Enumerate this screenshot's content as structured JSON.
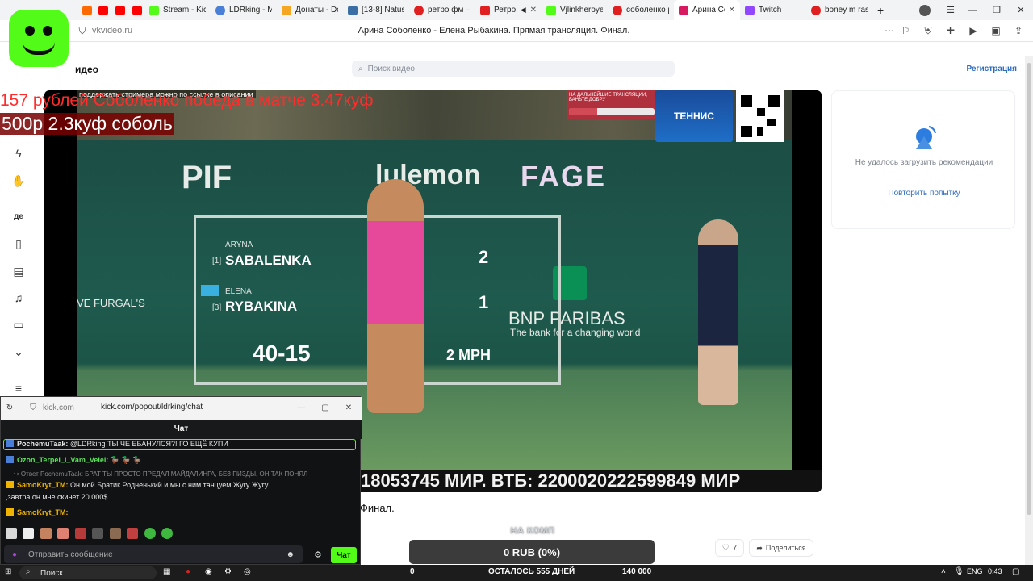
{
  "browser": {
    "tabs": [
      {
        "label": "",
        "color": "#ff6a00",
        "active": false
      },
      {
        "label": "",
        "color": "#ff0000",
        "active": false
      },
      {
        "label": "",
        "color": "#ff0000",
        "active": false
      },
      {
        "label": "",
        "color": "#ff0000",
        "active": false
      },
      {
        "label": "Stream - Kick",
        "color": "#53fc18",
        "active": false
      },
      {
        "label": "LDRking - Me",
        "color": "#4a7fd8",
        "active": false
      },
      {
        "label": "Донаты - Do",
        "color": "#f5a623",
        "active": false
      },
      {
        "label": "[13-8] Natus",
        "color": "#3a6ea5",
        "active": false
      },
      {
        "label": "ретро фм —",
        "color": "#e02020",
        "active": false
      },
      {
        "label": "Ретро F",
        "color": "#e02020",
        "active": false
      },
      {
        "label": "Vjlinkheroye",
        "color": "#53fc18",
        "active": false
      },
      {
        "label": "соболенко р",
        "color": "#e02020",
        "active": false
      },
      {
        "label": "Арина Со",
        "color": "#d81b60",
        "active": true
      },
      {
        "label": "Twitch",
        "color": "#9146ff",
        "active": false
      },
      {
        "label": "boney m rasp",
        "color": "#e02020",
        "active": false
      }
    ],
    "address_host": "vkvideo.ru",
    "page_title": "Арина Соболенко - Елена Рыбакина. Прямая трансляция. Финал."
  },
  "header": {
    "brand": "идео",
    "search_placeholder": "Поиск видео",
    "register": "Регистрация"
  },
  "stream_overlay": {
    "line1": "157 рублей Соболенко победа в матче 3.47куф",
    "line2": "500р 2.3куф соболь",
    "top_note": "поддержать стримера можно по ссылке в описании",
    "alert_text": "НА ДАЛЬНЕЙШИЕ ТРАНСЛЯЦИИ, БАНЬТЕ ДОБРУ",
    "alert_progress": 0.33,
    "tennis_logo": "ТЕННИС",
    "ticker": "18053745 МИР. ВТБ: 2200020222599849 МИР"
  },
  "court": {
    "sponsor_pif": "PIF",
    "sponsor_lulu": "lulemon",
    "sponsor_fage": "FAGE",
    "sponsor_bnp": "BNP PARIBAS",
    "sponsor_bnp_sub": "The bank for a changing world",
    "sponsor_left": "VE FURGAL'S",
    "player1_first": "ARYNA",
    "player1_last": "SABALENKA",
    "player1_seed": "[1]",
    "player1_set": "2",
    "player2_first": "ELENA",
    "player2_last": "RYBAKINA",
    "player2_seed": "[3]",
    "player2_set": "1",
    "game_score": "40-15",
    "speed": "2 MPH"
  },
  "recommendations": {
    "error": "Не удалось загрузить рекомендации",
    "retry": "Повторить попытку"
  },
  "video_info": {
    "title_fragment": "Финал.",
    "likes": "7",
    "share": "Поделиться"
  },
  "donation": {
    "label": "НА КОМП",
    "amount": "0 RUB (0%)",
    "left": "0",
    "remaining": "ОСТАЛОСЬ 555 ДНЕЙ",
    "goal": "140 000"
  },
  "chat": {
    "host": "kick.com",
    "path": "kick.com/popout/ldrking/chat",
    "header": "Чат",
    "messages": [
      {
        "user": "PochemuTaak:",
        "text": " @LDRking ТЫ ЧЕ ЕБАНУЛСЯ?! ГО ЕЩЁ КУПИ"
      },
      {
        "user": "Ozon_Terpel_I_Vam_Velel:",
        "text": " 🦆 🦆 🦆"
      },
      {
        "reply": "↪ Ответ PochemuTaak: БРАТ ТЫ ПРОСТО ПРЕДАЛ МАЙДАЛИНГА, БЕЗ ПИЗДЫ, ОН ТАК ПОНЯЛ"
      },
      {
        "user": "SamoKryt_TM:",
        "text": " Он мой Братик Родненький и мы с ним танцуем Жугу Жугу"
      },
      {
        "cont": ",завтра он мне скинет 20 000$"
      },
      {
        "user": "SamoKryt_TM:",
        "text": ""
      }
    ],
    "input_placeholder": "Отправить сообщение",
    "send": "Чат"
  },
  "taskbar": {
    "search": "Поиск",
    "lang": "ENG",
    "time": "0:43"
  }
}
